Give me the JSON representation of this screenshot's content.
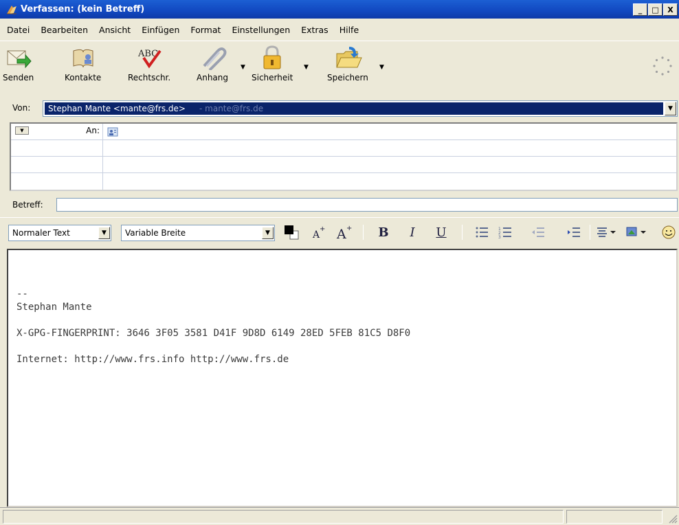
{
  "window": {
    "title": "Verfassen: (kein Betreff)",
    "controls": [
      "_",
      "□",
      "X"
    ]
  },
  "menu": [
    "Datei",
    "Bearbeiten",
    "Ansicht",
    "Einfügen",
    "Format",
    "Einstellungen",
    "Extras",
    "Hilfe"
  ],
  "toolbar": {
    "send": "Senden",
    "contacts": "Kontakte",
    "spell": "Rechtschr.",
    "attach": "Anhang",
    "security": "Sicherheit",
    "save": "Speichern"
  },
  "from": {
    "label": "Von:",
    "value": "Stephan Mante <mante@frs.de>",
    "account": "- mante@frs.de"
  },
  "recipients": {
    "type_label": "An:"
  },
  "subject": {
    "label": "Betreff:",
    "value": ""
  },
  "format": {
    "paragraph_style": "Normaler Text",
    "font": "Variable Breite",
    "bold": "B",
    "italic": "I",
    "underline": "U"
  },
  "body": {
    "signature_sep": "--",
    "name": "Stephan Mante",
    "fingerprint": "X-GPG-FINGERPRINT: 3646 3F05 3581 D41F 9D8D 6149 28ED 5FEB 81C5 D8F0",
    "internet": "Internet: http://www.frs.info http://www.frs.de"
  },
  "colors": {
    "titlebar": "#1148c0",
    "selection": "#0a246a",
    "chrome": "#ece9d8"
  }
}
